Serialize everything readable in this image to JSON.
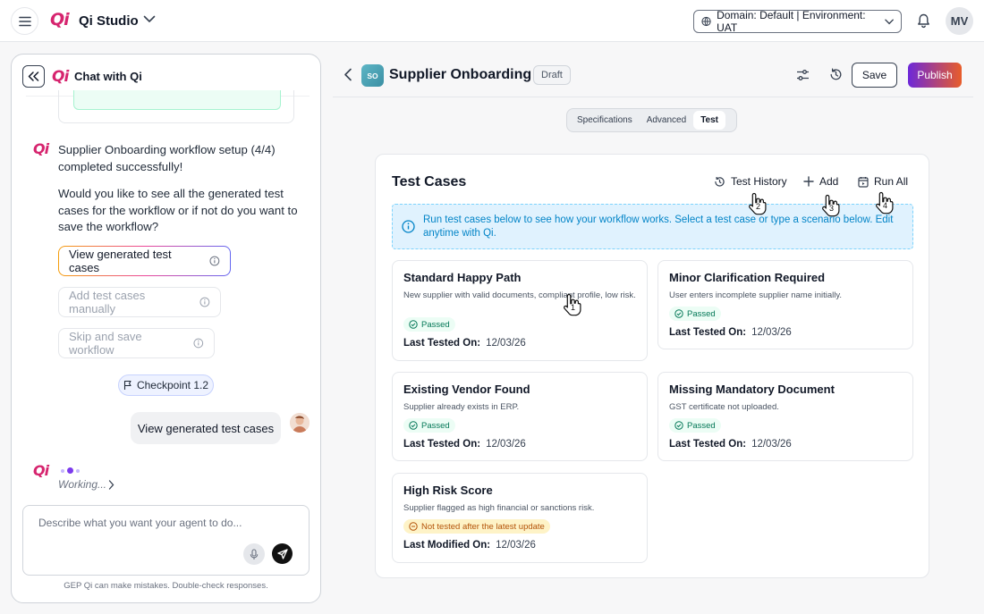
{
  "topbar": {
    "app_title": "Qi Studio",
    "logo_text": "Qi",
    "domain_label": "Domain: Default | Environment: UAT",
    "user_initials": "MV"
  },
  "chat": {
    "title": "Chat with Qi",
    "bot_message_1": "Supplier Onboarding workflow setup (4/4) completed successfully!",
    "bot_message_2": "Would you like to see all the generated test cases for the workflow or if not do you want to save the workflow?",
    "options": [
      {
        "label": "View generated test cases",
        "active": true
      },
      {
        "label": "Add test cases manually",
        "active": false
      },
      {
        "label": "Skip and save workflow",
        "active": false
      }
    ],
    "checkpoint_label": "Checkpoint 1.2",
    "user_message": "View generated test cases",
    "working_label": "Working...",
    "composer_placeholder": "Describe what you want your agent to do...",
    "disclaimer": "GEP Qi can make mistakes. Double-check responses."
  },
  "header": {
    "badge_initials": "SO",
    "title": "Supplier Onboarding",
    "status": "Draft",
    "save_label": "Save",
    "publish_label": "Publish"
  },
  "tabs": [
    {
      "label": "Specifications",
      "selected": false
    },
    {
      "label": "Advanced",
      "selected": false
    },
    {
      "label": "Test",
      "selected": true
    }
  ],
  "test_cases": {
    "title": "Test Cases",
    "actions": {
      "history": "Test History",
      "add": "Add",
      "run_all": "Run All"
    },
    "info": "Run test cases below to see how your workflow works. Select a test case or type a scenario below. Edit anytime with Qi.",
    "cards": [
      {
        "title": "Standard Happy Path",
        "desc": "New supplier with valid documents, compliant profile, low risk.",
        "status": "Passed",
        "date_label": "Last Tested On:",
        "date": "12/03/26"
      },
      {
        "title": "Minor Clarification Required",
        "desc": "User enters incomplete supplier name initially.",
        "status": "Passed",
        "date_label": "Last Tested On:",
        "date": "12/03/26"
      },
      {
        "title": "Existing Vendor Found",
        "desc": "Supplier already exists in ERP.",
        "status": "Passed",
        "date_label": "Last Tested On:",
        "date": "12/03/26"
      },
      {
        "title": "Missing Mandatory Document",
        "desc": "GST certificate not uploaded.",
        "status": "Passed",
        "date_label": "Last Tested On:",
        "date": "12/03/26"
      },
      {
        "title": "High Risk Score",
        "desc": "Supplier flagged as high financial or sanctions risk.",
        "status": "Not tested after the latest update",
        "date_label": "Last Modified On:",
        "date": "12/03/26"
      }
    ]
  },
  "cursor_markers": [
    "1",
    "2",
    "3",
    "4"
  ],
  "colors": {
    "brand_pink": "#d6246e",
    "publish_gradient_start": "#6d28d9",
    "publish_gradient_end": "#e85d2a",
    "passed_green": "#047857",
    "warning_amber": "#b45309",
    "info_blue": "#0284c7"
  }
}
